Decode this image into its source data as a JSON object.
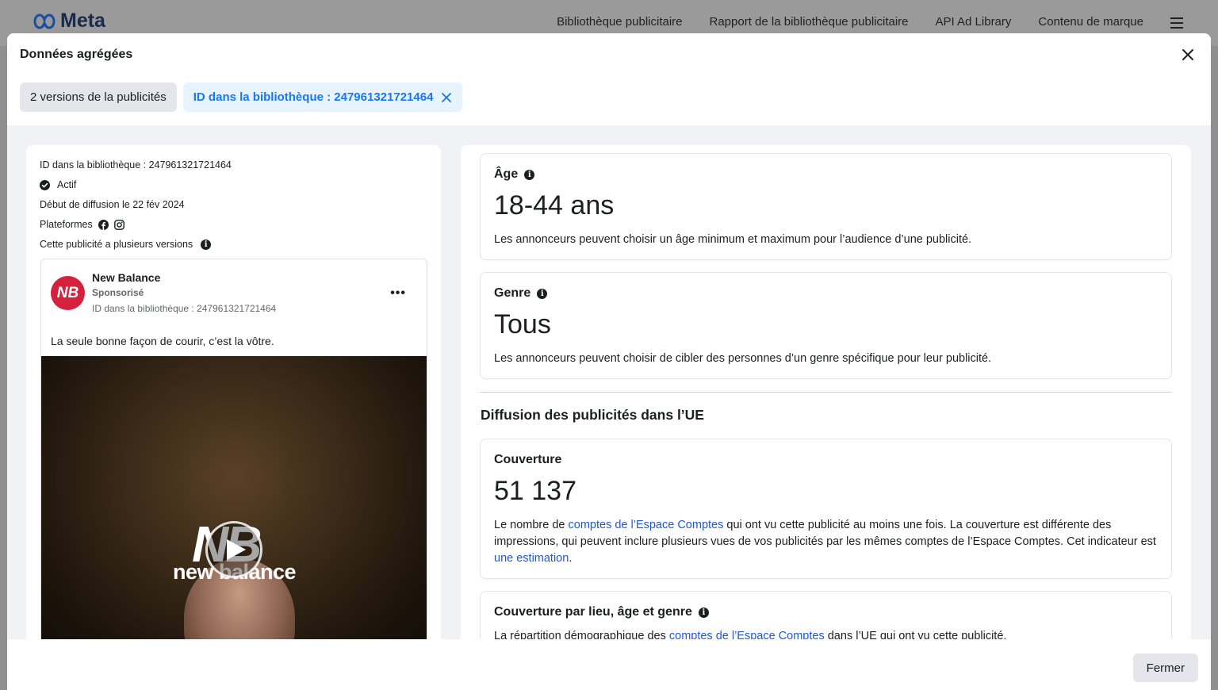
{
  "topnav": {
    "logo_text": "Meta",
    "links": [
      "Bibliothèque publicitaire",
      "Rapport de la bibliothèque publicitaire",
      "API Ad Library",
      "Contenu de marque"
    ]
  },
  "modal": {
    "title": "Données agrégées",
    "tabs": {
      "versions_label": "2 versions de la publicités",
      "id_label": "ID dans la bibliothèque : 247961321721464"
    },
    "close_button_label": "Fermer"
  },
  "ad_meta": {
    "library_id": "ID dans la bibliothèque : 247961321721464",
    "status": "Actif",
    "start_date": "Début de diffusion le 22 fév 2024",
    "platforms_label": "Plateformes",
    "versions_note": "Cette publicité a plusieurs versions"
  },
  "ad_card": {
    "advertiser": "New Balance",
    "sponsored": "Sponsorisé",
    "library_id": "ID dans la bibliothèque : 247961321721464",
    "body_text": "La seule bonne façon de courir, c’est la vôtre.",
    "video_brand_mark": "NB",
    "video_brand_word": "new balance",
    "avatar_initials": "NB"
  },
  "age_card": {
    "title": "Âge",
    "value": "18-44 ans",
    "description": "Les annonceurs peuvent choisir un âge minimum et maximum pour l’audience d’une publicité."
  },
  "gender_card": {
    "title": "Genre",
    "value": "Tous",
    "description": "Les annonceurs peuvent choisir de cibler des personnes d’un genre spécifique pour leur publicité."
  },
  "eu_section": {
    "title": "Diffusion des publicités dans l’UE"
  },
  "reach_card": {
    "title": "Couverture",
    "value": "51 137",
    "desc_part1": "Le nombre de ",
    "desc_link1": "comptes de l’Espace Comptes",
    "desc_part2": " qui ont vu cette publicité au moins une fois. La couverture est différente des impressions, qui peuvent inclure plusieurs vues de vos publicités par les mêmes comptes de l’Espace Comptes. Cet indicateur est ",
    "desc_link2": "une estimation",
    "desc_part3": "."
  },
  "demo_card": {
    "title": "Couverture par lieu, âge et genre",
    "desc_part1": "La répartition démographique des ",
    "desc_link1": "comptes de l’Espace Comptes",
    "desc_part2": " dans l’UE qui ont vu cette publicité."
  },
  "colors": {
    "accent_blue": "#1877f2",
    "link_blue": "#1f58d6",
    "brand_red": "#d4213d"
  }
}
